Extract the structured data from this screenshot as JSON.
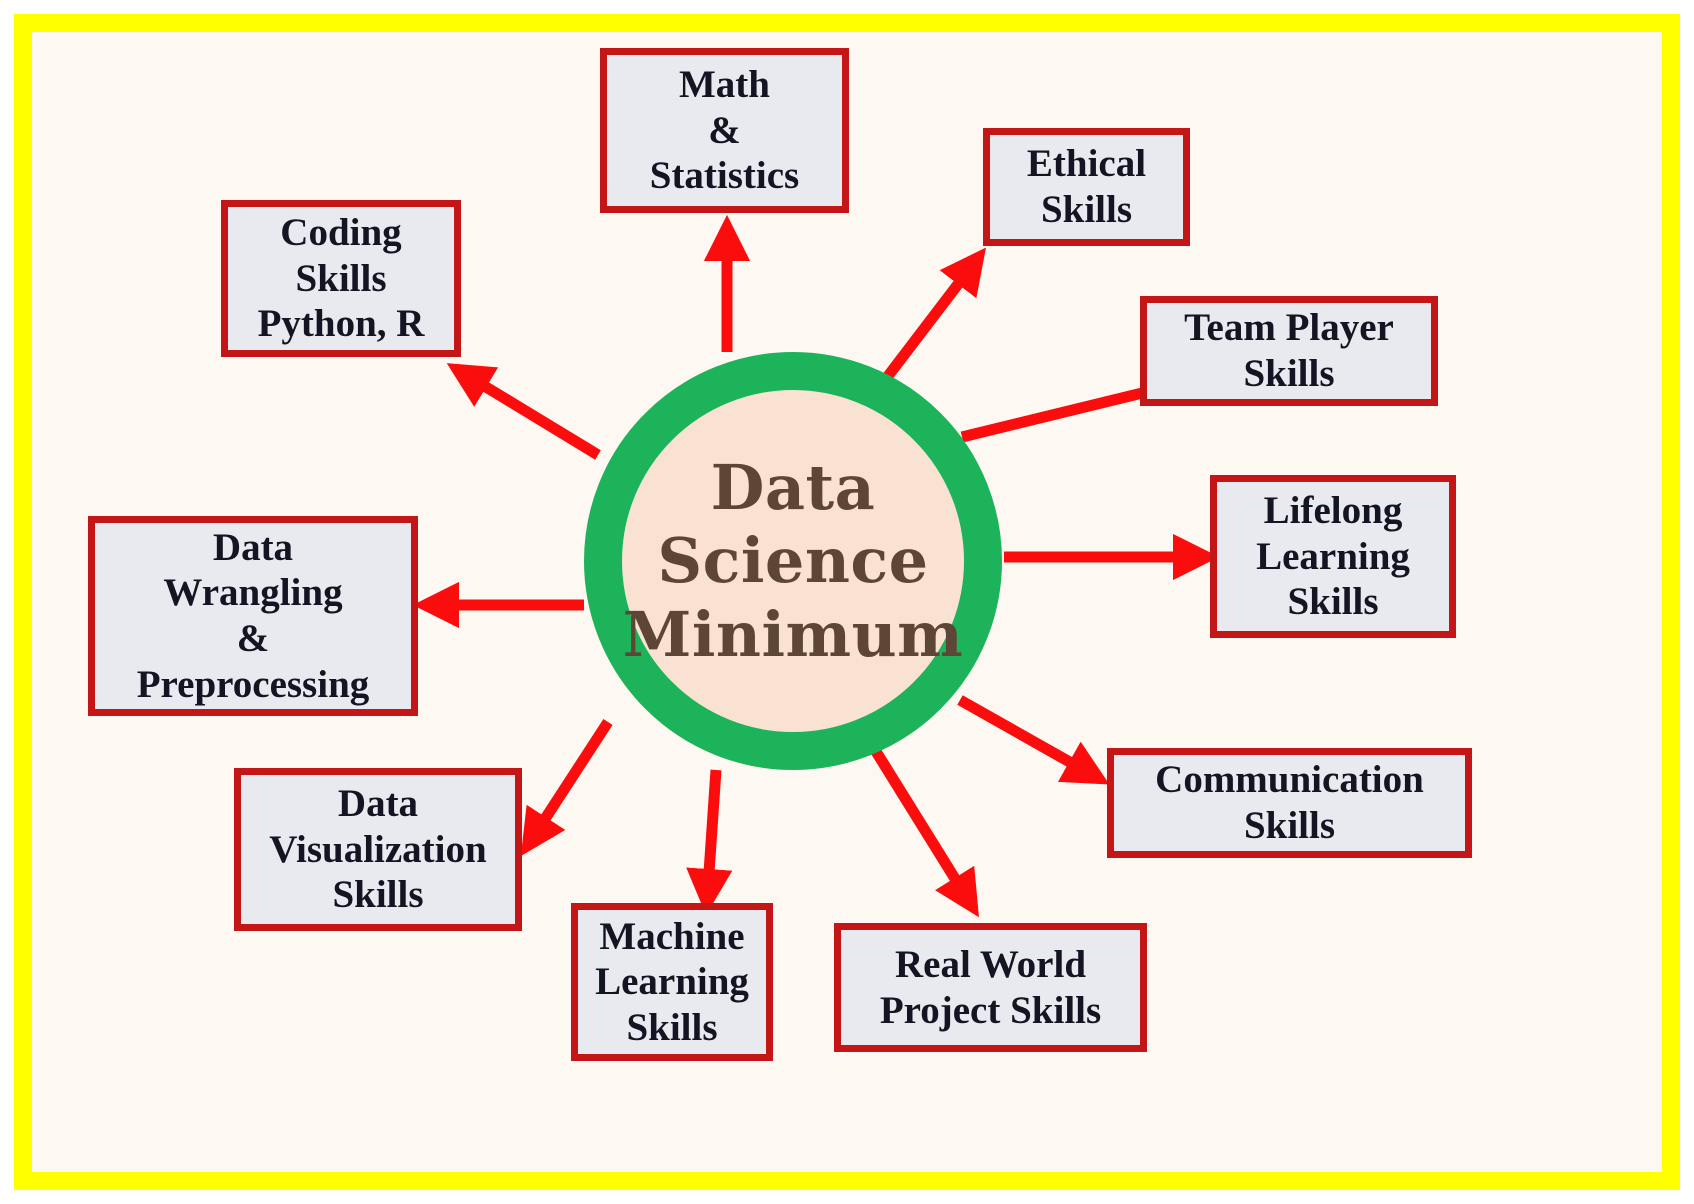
{
  "diagram": {
    "title": "Data Science Minimum",
    "center": {
      "label": "Data\nScience\nMinimum",
      "fill_color": "#f9e2d2",
      "ring_color": "#1cb35a",
      "text_color": "#5d4636"
    },
    "frame": {
      "border_color": "#ffff00",
      "background_color": "#fdf8f2"
    },
    "style": {
      "box_fill": "#e9e9f0",
      "box_border": "#c41616",
      "box_text": "#141422",
      "arrow_color": "#fc0d0d"
    },
    "nodes": [
      {
        "id": "math-statistics",
        "label": "Math\n&\nStatistics"
      },
      {
        "id": "coding-skills",
        "label": "Coding\nSkills\nPython, R"
      },
      {
        "id": "data-wrangling",
        "label": "Data\nWrangling\n&\nPreprocessing"
      },
      {
        "id": "data-visualization",
        "label": "Data\nVisualization\nSkills"
      },
      {
        "id": "machine-learning",
        "label": "Machine\nLearning\nSkills"
      },
      {
        "id": "real-world-project",
        "label": "Real World\nProject Skills"
      },
      {
        "id": "communication",
        "label": "Communication\nSkills"
      },
      {
        "id": "lifelong-learning",
        "label": "Lifelong\nLearning\nSkills"
      },
      {
        "id": "team-player",
        "label": "Team Player\nSkills"
      },
      {
        "id": "ethical-skills",
        "label": "Ethical\nSkills"
      }
    ]
  }
}
